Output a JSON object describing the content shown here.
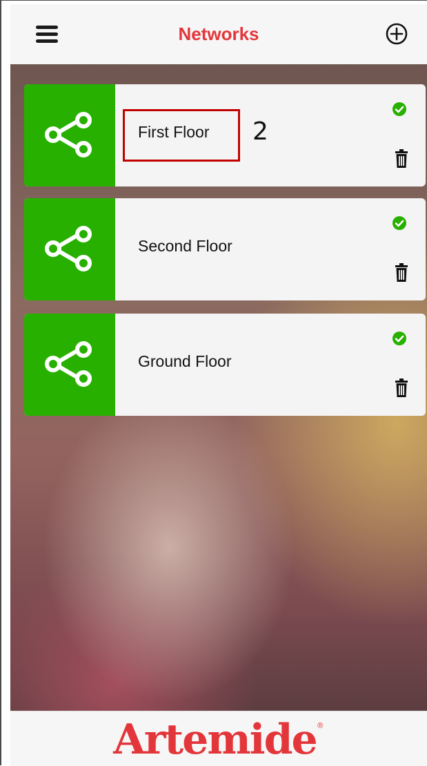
{
  "header": {
    "title": "Networks",
    "menu_icon": "hamburger-menu-icon",
    "add_icon": "plus-circle-icon"
  },
  "networks": [
    {
      "name": "First Floor",
      "status": "connected",
      "icon": "share-network-icon"
    },
    {
      "name": "Second Floor",
      "status": "connected",
      "icon": "share-network-icon"
    },
    {
      "name": "Ground Floor",
      "status": "connected",
      "icon": "share-network-icon"
    }
  ],
  "annotation": {
    "label": "2"
  },
  "footer": {
    "brand": "Artemide",
    "registered_mark": "®"
  },
  "colors": {
    "accent": "#e3363b",
    "tile": "#27b000",
    "status_ok": "#27b000",
    "card": "#f4f4f4"
  }
}
